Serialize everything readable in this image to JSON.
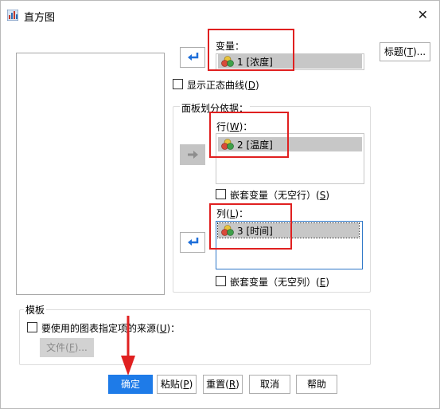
{
  "window": {
    "title": "直方图"
  },
  "variable": {
    "label": "变量：",
    "value": "1 [浓度]"
  },
  "normal_curve": {
    "label": "显示正态曲线(",
    "key": "D",
    "suffix": ")"
  },
  "panel": {
    "group_label": "面板划分依据：",
    "row": {
      "label": "行(",
      "key": "W",
      "suffix": ")：",
      "value": "2 [温度]",
      "nest": {
        "label": "嵌套变量（无空行）(",
        "key": "S",
        "suffix": ")"
      }
    },
    "col": {
      "label": "列(",
      "key": "L",
      "suffix": ")：",
      "value": "3 [时间]",
      "nest": {
        "label": "嵌套变量（无空列）(",
        "key": "E",
        "suffix": ")"
      }
    }
  },
  "title_button": {
    "label": "标题(",
    "key": "T",
    "suffix": ")..."
  },
  "template": {
    "group_label": "模板",
    "use_label": "要使用的图表指定项的来源(",
    "use_key": "U",
    "use_suffix": ")：",
    "file_button": {
      "label": "文件(",
      "key": "F",
      "suffix": ")..."
    }
  },
  "buttons": {
    "ok": "确定",
    "paste": {
      "label": "粘贴(",
      "key": "P",
      "suffix": ")"
    },
    "reset": {
      "label": "重置(",
      "key": "R",
      "suffix": ")"
    },
    "cancel": "取消",
    "help": "帮助"
  },
  "colors": {
    "primary": "#1e7be8",
    "highlight": "#e02020",
    "arrow_icon": "#1e6fd9",
    "list_select": "#c7c7c7"
  }
}
